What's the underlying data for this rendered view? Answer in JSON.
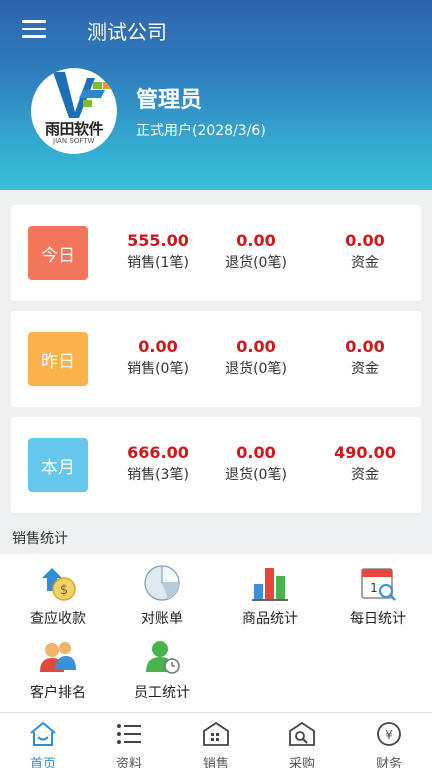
{
  "header": {
    "company": "测试公司",
    "logo_text": "雨田软件",
    "logo_sub": "JIAN SOFTW",
    "user_name": "管理员",
    "user_status": "正式用户(2028/3/6)"
  },
  "cards": [
    {
      "badge": "今日",
      "badge_color": "#f2765a",
      "stats": [
        {
          "value": "555.00",
          "label": "销售(1笔)"
        },
        {
          "value": "0.00",
          "label": "退货(0笔)"
        },
        {
          "value": "0.00",
          "label": "资金"
        }
      ]
    },
    {
      "badge": "昨日",
      "badge_color": "#fbb24a",
      "stats": [
        {
          "value": "0.00",
          "label": "销售(0笔)"
        },
        {
          "value": "0.00",
          "label": "退货(0笔)"
        },
        {
          "value": "0.00",
          "label": "资金"
        }
      ]
    },
    {
      "badge": "本月",
      "badge_color": "#66c6ec",
      "stats": [
        {
          "value": "666.00",
          "label": "销售(3笔)"
        },
        {
          "value": "0.00",
          "label": "退货(0笔)"
        },
        {
          "value": "490.00",
          "label": "资金"
        }
      ]
    }
  ],
  "section": {
    "title": "销售统计"
  },
  "grid": [
    {
      "label": "查应收款",
      "icon": "receivable-icon"
    },
    {
      "label": "对账单",
      "icon": "statement-pie-icon"
    },
    {
      "label": "商品统计",
      "icon": "bar-chart-icon"
    },
    {
      "label": "每日统计",
      "icon": "calendar-icon"
    },
    {
      "label": "客户排名",
      "icon": "customers-icon"
    },
    {
      "label": "员工统计",
      "icon": "employee-icon"
    }
  ],
  "tabs": [
    {
      "label": "首页",
      "icon": "home-icon",
      "active": true
    },
    {
      "label": "资料",
      "icon": "list-icon",
      "active": false
    },
    {
      "label": "销售",
      "icon": "sales-icon",
      "active": false
    },
    {
      "label": "采购",
      "icon": "purchase-icon",
      "active": false
    },
    {
      "label": "财务",
      "icon": "yen-icon",
      "active": false
    }
  ],
  "colors": {
    "accent": "#2c8fd4",
    "value_red": "#d0181b"
  }
}
